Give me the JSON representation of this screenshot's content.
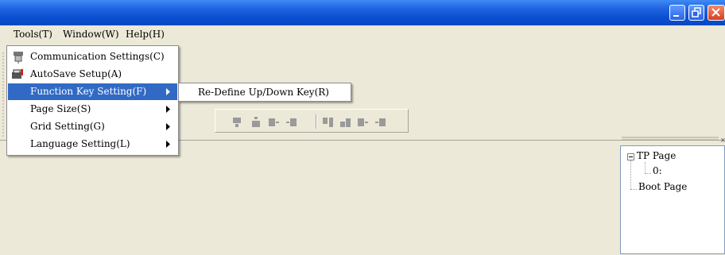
{
  "menubar": {
    "items": [
      {
        "label": "Tools(T)"
      },
      {
        "label": "Window(W)"
      },
      {
        "label": "Help(H)"
      }
    ]
  },
  "tools_menu": {
    "items": [
      {
        "label": "Communication Settings(C)",
        "icon": "communication-icon"
      },
      {
        "label": "AutoSave Setup(A)",
        "icon": "autosave-icon"
      },
      {
        "label": "Function Key Setting(F)",
        "has_submenu": true,
        "selected": true
      },
      {
        "label": "Page Size(S)",
        "has_submenu": true
      },
      {
        "label": "Grid Setting(G)",
        "has_submenu": true
      },
      {
        "label": "Language Setting(L)",
        "has_submenu": true
      }
    ]
  },
  "function_key_submenu": {
    "items": [
      {
        "label": "Re-Define Up/Down Key(R)"
      }
    ]
  },
  "page_tree": {
    "root": "TP Page",
    "children": [
      "0:"
    ],
    "sibling": "Boot Page"
  },
  "colors": {
    "titlebar": "#0a4fd1",
    "menu_highlight": "#316ac5",
    "window_bg": "#ece9d8"
  }
}
